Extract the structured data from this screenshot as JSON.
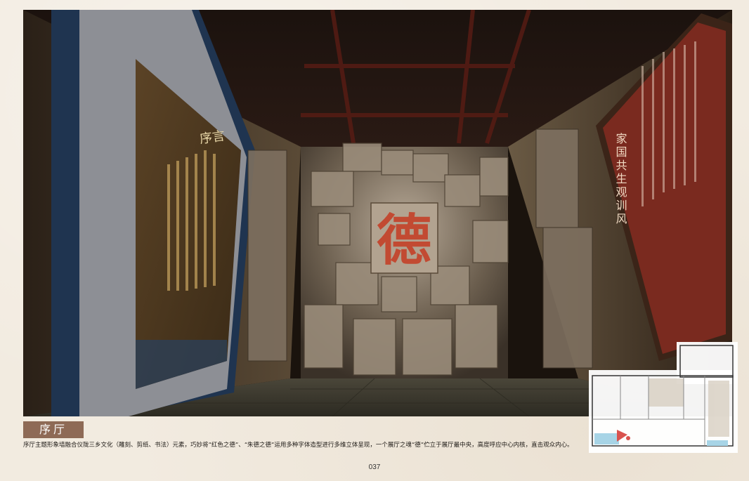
{
  "section": {
    "title": "序厅"
  },
  "description": "序厅主题形象墙融合仪陇三乡文化（雕刻、剪纸、书法）元素，巧妙将“红色之德”、“朱德之德”运用多种字体造型进行多维立体呈现，一个展厅之魂“德”伫立于展厅最中央，高度呼应中心内核，直击观众内心。",
  "page_number": "037",
  "rendering": {
    "central_character": "德",
    "left_plaque_title": "序言",
    "right_panel_title": "家国共生观训风"
  },
  "colors": {
    "accent": "#8e6a56",
    "character_red": "#c24a32",
    "panel_red": "#7a2a1f"
  }
}
